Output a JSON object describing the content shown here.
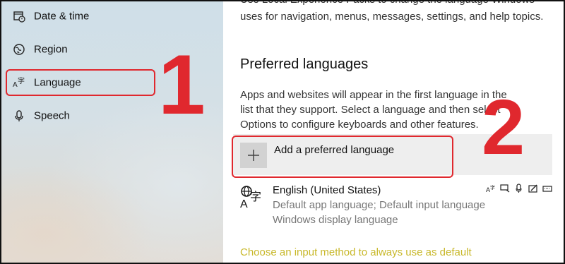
{
  "sidebar": {
    "items": [
      {
        "label": "Date & time",
        "icon": "clock-calendar-icon"
      },
      {
        "label": "Region",
        "icon": "globe-icon"
      },
      {
        "label": "Language",
        "icon": "language-icon"
      },
      {
        "label": "Speech",
        "icon": "microphone-icon"
      }
    ]
  },
  "annotations": {
    "step1": "1",
    "step2": "2",
    "color": "#e0282e"
  },
  "main": {
    "intro_text": "Use Local Experience Packs to change the language Windows uses for navigation, menus, messages, settings, and help topics.",
    "section_title": "Preferred languages",
    "section_desc": "Apps and websites will appear in the first language in the list that they support. Select a language and then select Options to configure keyboards and other features.",
    "add_button_label": "Add a preferred language",
    "language": {
      "name": "English (United States)",
      "line1": "Default app language; Default input language",
      "line2": "Windows display language",
      "feature_icons": [
        "display-language-icon",
        "speech-recognition-icon",
        "text-to-speech-icon",
        "handwriting-icon",
        "keyboard-icon"
      ]
    },
    "link_text": "Choose an input method to always use as default",
    "link_color": "#c8b82a"
  }
}
